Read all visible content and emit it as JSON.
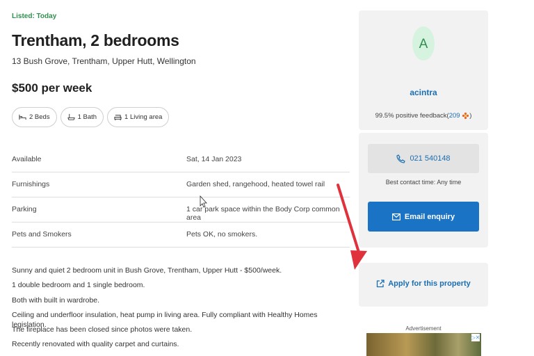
{
  "listing": {
    "listed": "Listed: Today",
    "title": "Trentham, 2 bedrooms",
    "address": "13 Bush Grove, Trentham, Upper Hutt, Wellington",
    "price": "$500 per week",
    "features": [
      {
        "label": "2 Beds",
        "icon": "bed-icon"
      },
      {
        "label": "1 Bath",
        "icon": "bath-icon"
      },
      {
        "label": "1 Living area",
        "icon": "sofa-icon"
      }
    ]
  },
  "details": [
    {
      "label": "Available",
      "value": "Sat, 14 Jan 2023"
    },
    {
      "label": "Furnishings",
      "value": "Garden shed, rangehood, heated towel rail"
    },
    {
      "label": "Parking",
      "value": "1 car park space within the Body Corp common area"
    },
    {
      "label": "Pets and Smokers",
      "value": "Pets OK, no smokers."
    }
  ],
  "description": [
    "Sunny and quiet 2 bedroom unit in Bush Grove, Trentham, Upper Hutt - $500/week.",
    "1 double bedroom and 1 single bedroom.",
    "Both with built in wardrobe.",
    "Ceiling and underfloor insulation, heat pump in living area. Fully compliant with Healthy Homes legislation.",
    "The fireplace has been closed since photos were taken.",
    "Recently renovated with quality carpet and curtains."
  ],
  "agent": {
    "initial": "A",
    "username": "acintra",
    "feedback_prefix": "99.5% positive feedback(",
    "feedback_count": "209",
    "feedback_suffix": ")",
    "phone": "021 540148",
    "best_time": "Best contact time: Any time",
    "email_label": "Email enquiry"
  },
  "apply": {
    "label": "Apply for this property"
  },
  "ad": {
    "label": "Advertisement"
  },
  "colors": {
    "accent": "#1b73c5",
    "link": "#1a6eb3",
    "listed_green": "#2f8f4e",
    "card_bg": "#f2f2f2",
    "annotation_arrow": "#e0323c"
  }
}
